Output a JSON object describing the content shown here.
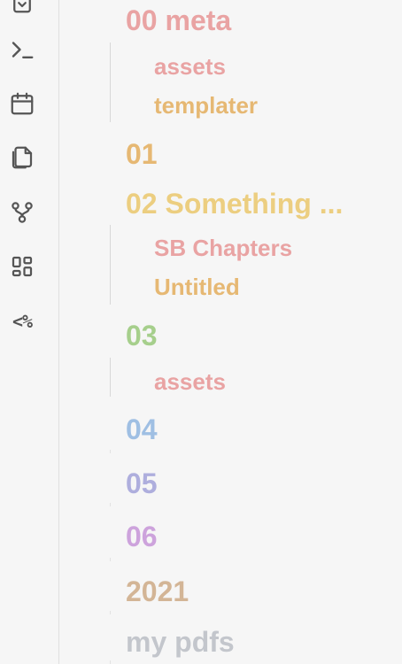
{
  "ribbon": {
    "icons": [
      {
        "name": "open-quick-switcher-icon"
      },
      {
        "name": "terminal-icon"
      },
      {
        "name": "calendar-icon"
      },
      {
        "name": "copy-files-icon"
      },
      {
        "name": "graph-view-icon"
      },
      {
        "name": "dashboard-icon"
      },
      {
        "name": "templater-icon",
        "text": "<%"
      }
    ]
  },
  "explorer": {
    "folders": {
      "meta": {
        "label": "00 meta",
        "color": "#e9a3a3"
      },
      "meta_assets": {
        "label": "assets",
        "color": "#e9a3a3"
      },
      "meta_templater": {
        "label": "templater",
        "color": "#e6b873"
      },
      "f01": {
        "label": "01",
        "color": "#e6b873"
      },
      "f02": {
        "label": "02 Something ...",
        "color": "#ecce80"
      },
      "f02_sb": {
        "label": "SB Chapters",
        "color": "#e9a3a3"
      },
      "f02_untitled": {
        "label": "Untitled",
        "color": "#e6b873"
      },
      "f03": {
        "label": "03",
        "color": "#a6cf8c"
      },
      "f03_assets": {
        "label": "assets",
        "color": "#e9a3a3"
      },
      "f04": {
        "label": "04",
        "color": "#9fbfe3"
      },
      "f05": {
        "label": "05",
        "color": "#aeaedd"
      },
      "f06": {
        "label": "06",
        "color": "#cda3dc"
      },
      "f2021": {
        "label": "2021",
        "color": "#d3b596"
      },
      "pdfs": {
        "label": "my pdfs",
        "color": "#c3c6cc"
      }
    }
  }
}
